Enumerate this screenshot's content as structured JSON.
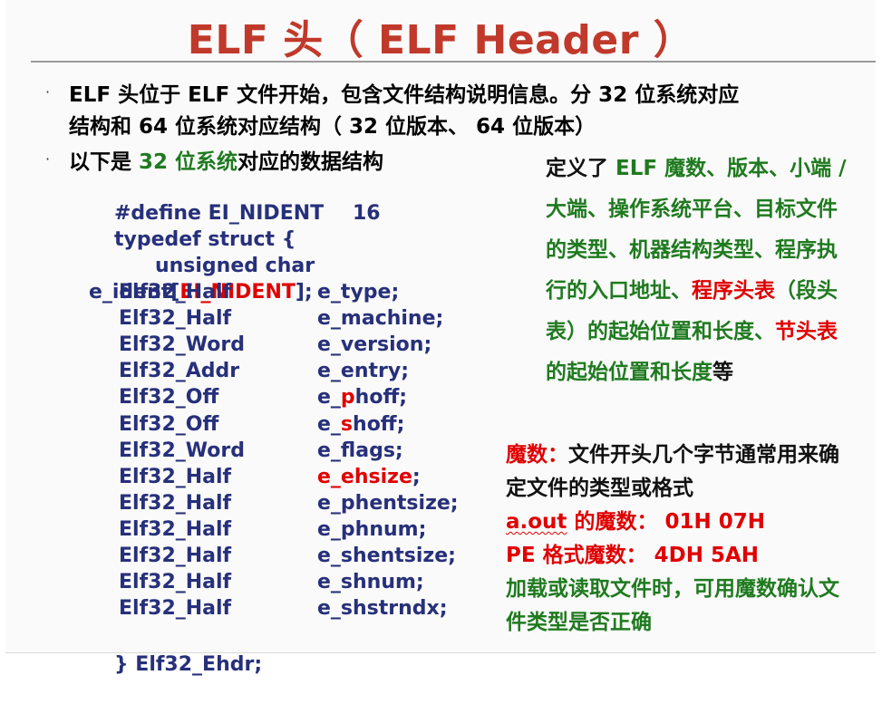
{
  "title": "ELF 头（ ELF Header ）",
  "bullets": [
    {
      "line1": "ELF 头位于 ELF 文件开始，包含文件结构说明信息。分 32 位系统对应",
      "line2": "结构和 64 位系统对应结构（ 32 位版本、 64 位版本）"
    },
    {
      "prefix": "以下是 ",
      "highlight": "32 位系统",
      "suffix": "对应的数据结构"
    }
  ],
  "code": {
    "define": "#define EI_NIDENT",
    "define_value": "16",
    "typedef": "typedef struct {",
    "unsigned_char": "unsigned char",
    "ident_prefix": "e_ident[",
    "ident_macro": "EI_NIDENT",
    "ident_suffix": "];",
    "fields": [
      {
        "type": "Elf32_Half",
        "pre": "e_type;",
        "hl": "",
        "post": ""
      },
      {
        "type": "Elf32_Half",
        "pre": "e_machine;",
        "hl": "",
        "post": ""
      },
      {
        "type": "Elf32_Word",
        "pre": "e_version;",
        "hl": "",
        "post": ""
      },
      {
        "type": "Elf32_Addr",
        "pre": "e_entry;",
        "hl": "",
        "post": ""
      },
      {
        "type": "Elf32_Off",
        "pre": "e_",
        "hl": "p",
        "post": "hoff;"
      },
      {
        "type": "Elf32_Off",
        "pre": "e_",
        "hl": "s",
        "post": "hoff;"
      },
      {
        "type": "Elf32_Word",
        "pre": "e_flags;",
        "hl": "",
        "post": ""
      },
      {
        "type": "Elf32_Half",
        "pre": "",
        "hl": "e_ehsize",
        "post": ";"
      },
      {
        "type": "Elf32_Half",
        "pre": "e_phentsize;",
        "hl": "",
        "post": ""
      },
      {
        "type": "Elf32_Half",
        "pre": "e_phnum;",
        "hl": "",
        "post": ""
      },
      {
        "type": "Elf32_Half",
        "pre": "e_shentsize;",
        "hl": "",
        "post": ""
      },
      {
        "type": "Elf32_Half",
        "pre": "e_shnum;",
        "hl": "",
        "post": ""
      },
      {
        "type": "Elf32_Half",
        "pre": "e_shstrndx;",
        "hl": "",
        "post": ""
      }
    ],
    "closing": "} Elf32_Ehdr;"
  },
  "right": {
    "seg1": "定义了 ",
    "seg2": "ELF 魔数、版本、小端 / 大端、操作系统平台、目标文件的类型、机器结构类型、程序执行的入口地址、",
    "seg3": "程序头表",
    "seg4": "（段头表）的起始位置和长度、",
    "seg5": "节头表",
    "seg6": "的起始位置和长度",
    "seg7": "等"
  },
  "magic": {
    "label": "魔数：",
    "desc": "文件开头几个字节通常用来确定文件的类型或格式",
    "aout_name": "a.out",
    "aout_label": " 的魔数： ",
    "aout_value": "01H 07H",
    "pe_label": "PE 格式魔数： ",
    "pe_value": "4DH 5AH",
    "note": "加载或读取文件时，可用魔数确认文件类型是否正确"
  },
  "colors": {
    "title": "#c0392b",
    "code": "#27307a",
    "green": "#1f7a1f",
    "red": "#e00000"
  }
}
